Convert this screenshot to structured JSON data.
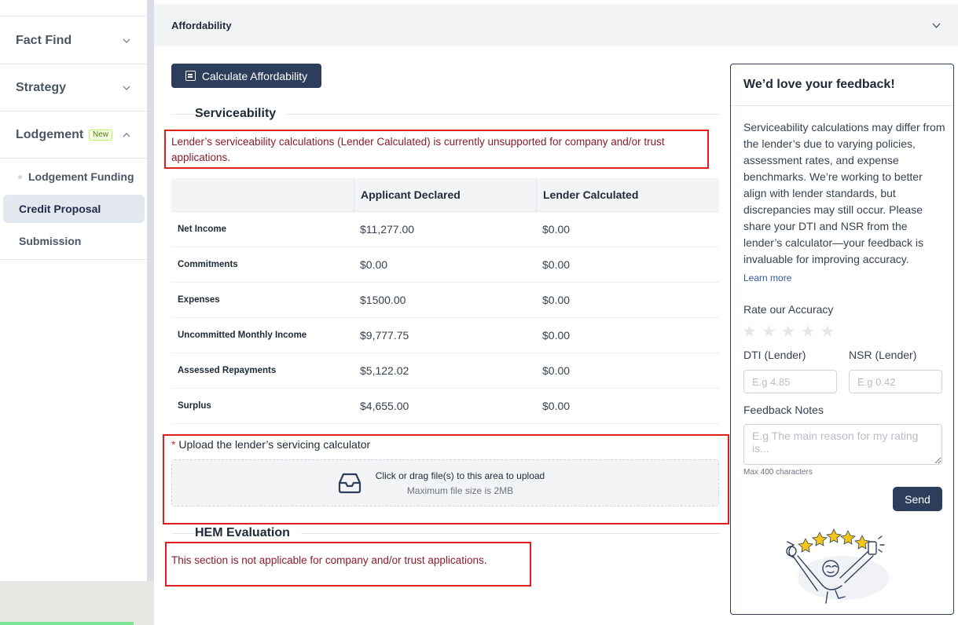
{
  "sidebar": {
    "sections": [
      {
        "label": "Fact Find",
        "chevron": "chevron-down-icon"
      },
      {
        "label": "Strategy",
        "chevron": "chevron-down-icon"
      },
      {
        "label": "Lodgement",
        "badge": "New",
        "chevron": "chevron-up-icon"
      }
    ],
    "sub_items": [
      {
        "label": "Lodgement Funding"
      },
      {
        "label": "Credit Proposal",
        "active": true
      },
      {
        "label": "Submission"
      }
    ]
  },
  "accordion": {
    "title": "Affordability"
  },
  "actions": {
    "calculate_label": "Calculate Affordability"
  },
  "serviceability": {
    "title": "Serviceability",
    "error": "Lender’s serviceability calculations (Lender Calculated) is currently unsupported for company and/or trust applications.",
    "columns": [
      "",
      "Applicant Declared",
      "Lender Calculated"
    ],
    "rows": [
      {
        "label": "Net Income",
        "declared": "$11,277.00",
        "calculated": "$0.00"
      },
      {
        "label": "Commitments",
        "declared": "$0.00",
        "calculated": "$0.00"
      },
      {
        "label": "Expenses",
        "declared": "$1500.00",
        "calculated": "$0.00"
      },
      {
        "label": "Uncommitted Monthly Income",
        "declared": "$9,777.75",
        "calculated": "$0.00"
      },
      {
        "label": "Assessed Repayments",
        "declared": "$5,122.02",
        "calculated": "$0.00"
      },
      {
        "label": "Surplus",
        "declared": "$4,655.00",
        "calculated": "$0.00"
      }
    ]
  },
  "upload": {
    "required_mark": "*",
    "label": "Upload the lender’s servicing calculator",
    "drop_text": "Click or drag file(s) to this area to upload",
    "limit_text": "Maximum file size is 2MB"
  },
  "hem": {
    "title": "HEM Evaluation",
    "error": "This section is not applicable for company and/or trust applications."
  },
  "feedback": {
    "title": "We’d love your feedback!",
    "body": "Serviceability calculations may differ from the lender’s due to varying policies, assessment rates, and expense benchmarks. We’re working to better align with lender standards, but discrepancies may still occur. Please share your DTI and NSR from the lender’s calculator—your feedback is invaluable for improving accuracy.",
    "learn_more": "Learn more",
    "rate_label": "Rate our Accuracy",
    "rating": 0,
    "dti_label": "DTI (Lender)",
    "dti_placeholder": "E.g 4.85",
    "nsr_label": "NSR (Lender)",
    "nsr_placeholder": "E.g 0.42",
    "notes_label": "Feedback Notes",
    "notes_placeholder": "E.g The main reason for my rating is...",
    "max_chars": "Max 400 characters",
    "send_label": "Send"
  },
  "colors": {
    "primary": "#2d3e5c",
    "error_text": "#8b1c2a",
    "highlight_box": "#e11d20"
  }
}
